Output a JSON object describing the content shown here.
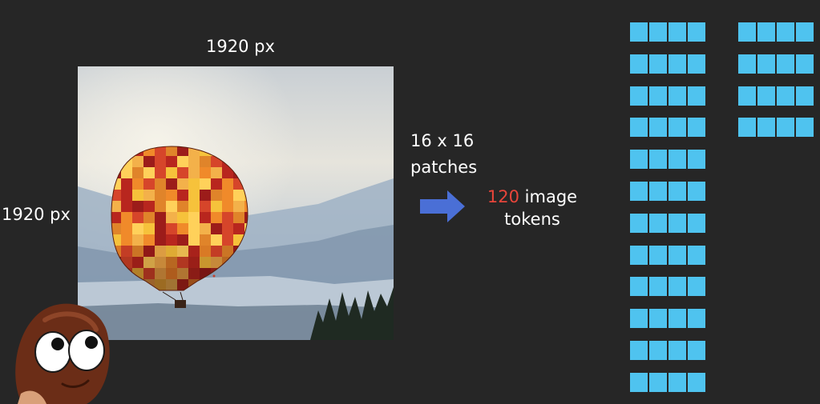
{
  "labels": {
    "width": "1920 px",
    "height": "1920 px",
    "patches_line1": "16 x 16",
    "patches_line2": "patches",
    "token_count": "120",
    "token_word1": " image",
    "token_word2": "tokens"
  },
  "colors": {
    "background": "#262626",
    "token_fill": "#4fc3ef",
    "arrow": "#4a6fd6",
    "accent": "#e8453a"
  },
  "icons": {
    "arrow": "right-arrow-icon",
    "mascot": "coffee-bean-mascot-icon"
  },
  "token_grid": {
    "left_column_count": 12,
    "right_column_count": 4,
    "cells_per_token": 4
  }
}
